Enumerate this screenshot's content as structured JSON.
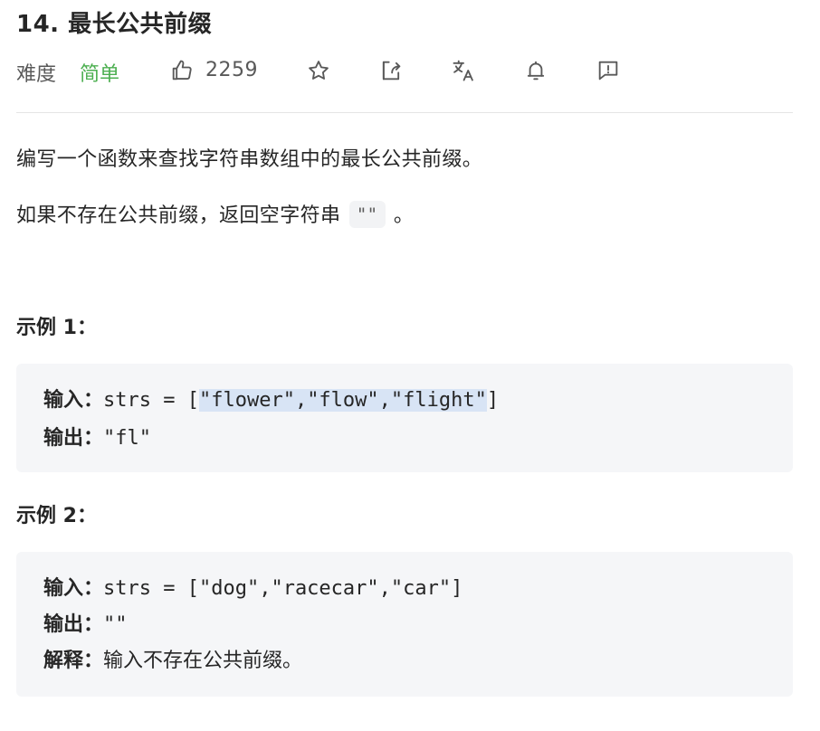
{
  "problem": {
    "title": "14. 最长公共前缀",
    "difficulty_label": "难度",
    "difficulty_value": "简单",
    "like_count": "2259",
    "difficulty_color": "#4caf50"
  },
  "toolbar": {
    "icons": [
      "thumbs-up-icon",
      "star-icon",
      "share-icon",
      "translate-icon",
      "bell-icon",
      "feedback-icon"
    ]
  },
  "description": {
    "para1": "编写一个函数来查找字符串数组中的最长公共前缀。",
    "para2_prefix": "如果不存在公共前缀，返回空字符串",
    "para2_code": "\"\"",
    "para2_suffix": "。"
  },
  "examples": [
    {
      "heading": "示例 1：",
      "input_label": "输入：",
      "input_prefix": "strs = [",
      "input_highlighted": "\"flower\",\"flow\",\"flight\"",
      "input_suffix": "]",
      "output_label": "输出：",
      "output_value": "\"fl\""
    },
    {
      "heading": "示例 2：",
      "input_label": "输入：",
      "input_value": "strs = [\"dog\",\"racecar\",\"car\"]",
      "output_label": "输出：",
      "output_value": "\"\"",
      "explain_label": "解释：",
      "explain_value": "输入不存在公共前缀。"
    }
  ]
}
